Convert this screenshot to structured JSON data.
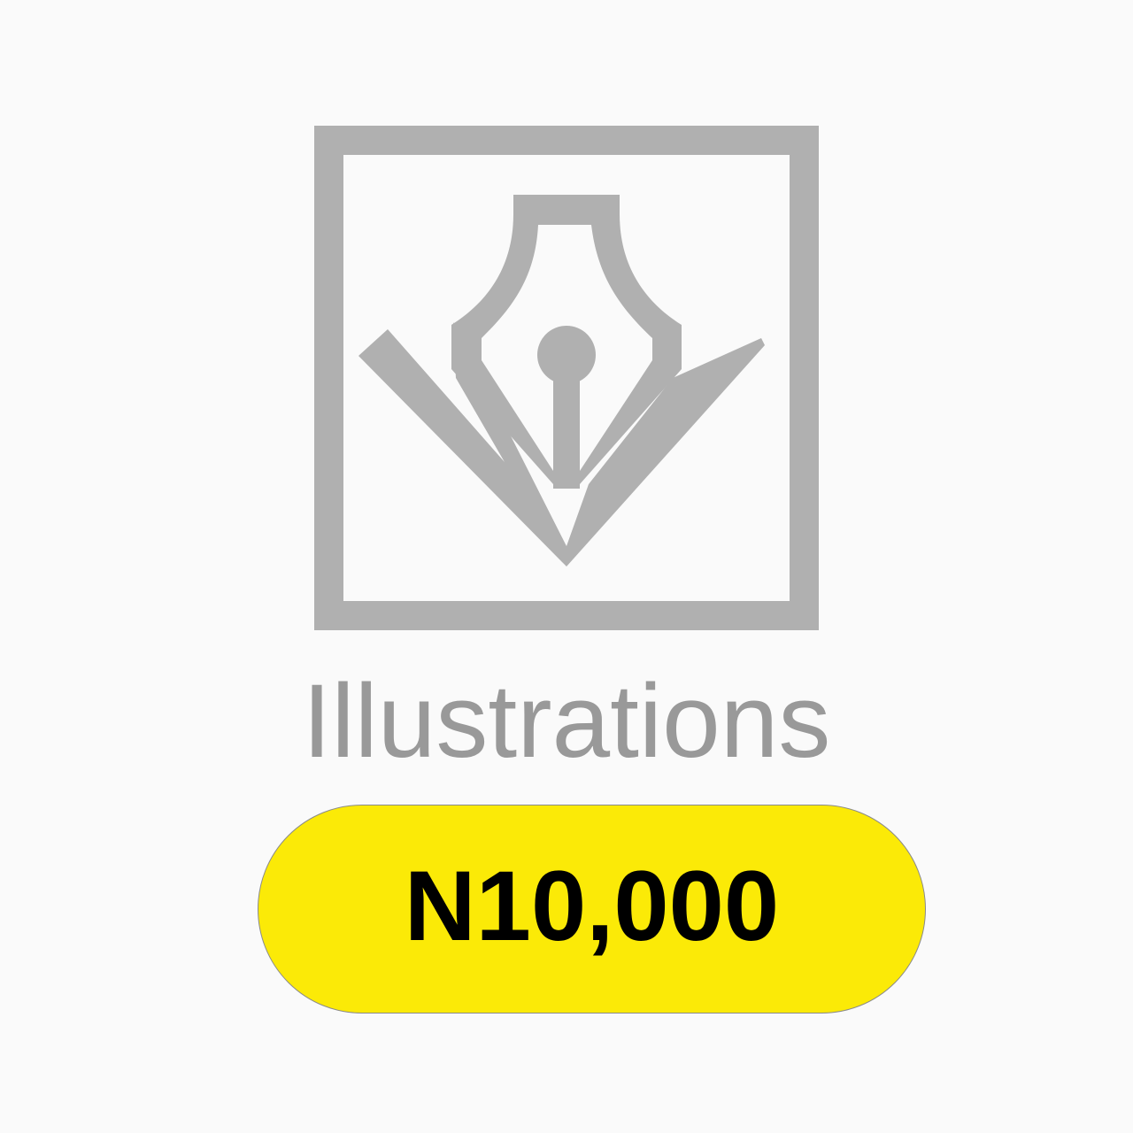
{
  "colors": {
    "background": "#fafafa",
    "icon_gray": "#b0b0b0",
    "title_gray": "#999999",
    "pill_yellow": "#fbea07",
    "price_text": "#000000"
  },
  "icon": {
    "name": "pen-nib-icon"
  },
  "product": {
    "title": "Illustrations",
    "price": "N10,000"
  }
}
